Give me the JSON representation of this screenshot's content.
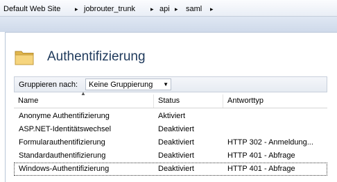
{
  "breadcrumb": {
    "items": [
      "Default Web Site",
      "jobrouter_trunk",
      "api",
      "saml"
    ],
    "separator": "▸"
  },
  "page": {
    "title": "Authentifizierung",
    "icon": "folder-icon"
  },
  "grouping": {
    "label": "Gruppieren nach:",
    "selected": "Keine Gruppierung"
  },
  "table": {
    "columns": [
      "Name",
      "Status",
      "Antworttyp"
    ],
    "rows": [
      [
        "Anonyme Authentifizierung",
        "Aktiviert",
        ""
      ],
      [
        "ASP.NET-Identitätswechsel",
        "Deaktiviert",
        ""
      ],
      [
        "Formularauthentifizierung",
        "Deaktiviert",
        "HTTP 302 - Anmeldung..."
      ],
      [
        "Standardauthentifizierung",
        "Deaktiviert",
        "HTTP 401 - Abfrage"
      ],
      [
        "Windows-Authentifizierung",
        "Deaktiviert",
        "HTTP 401 - Abfrage"
      ]
    ],
    "selected_row": 4
  },
  "colors": {
    "title": "#1e395b",
    "band": "#d8e1ee"
  }
}
